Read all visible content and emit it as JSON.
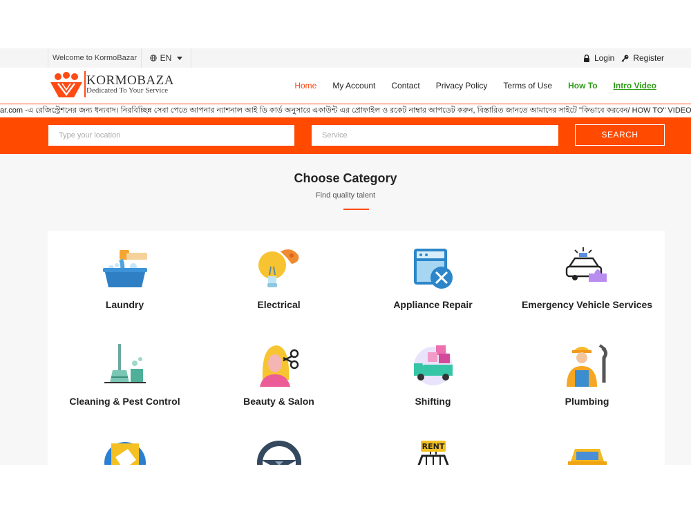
{
  "topbar": {
    "welcome": "Welcome to KormoBazar",
    "language": "EN",
    "login": "Login",
    "register": "Register"
  },
  "logo": {
    "brand": "KORMOBAZAR",
    "tagline": "Dedicated To Your Service"
  },
  "nav": {
    "items": [
      "Home",
      "My Account",
      "Contact",
      "Privacy Policy",
      "Terms of Use",
      "How To",
      "Intro Video"
    ]
  },
  "marquee": {
    "text": "ar.com -এ রেজিস্ট্রেশনের জন্য ধন্যবাদ। নিরবিচ্ছিন্ন সেবা পেতে আপনার ন্যাশনাল আই ডি কার্ড অনুসারে একাউন্ট এর প্রোফাইল ও রকেট নাম্বার আপডেট করুন, বিস্তারিত জানতে আমাদের সাইটে \"কিভাবে করবেন/ HOW TO\" VIDEO গু"
  },
  "search": {
    "location_placeholder": "Type your location",
    "service_placeholder": "Service",
    "button": "SEARCH"
  },
  "section": {
    "title": "Choose Category",
    "subtitle": "Find quality talent"
  },
  "categories": [
    {
      "label": "Laundry",
      "icon": "laundry-icon"
    },
    {
      "label": "Electrical",
      "icon": "lightbulb-icon"
    },
    {
      "label": "Appliance Repair",
      "icon": "appliance-repair-icon"
    },
    {
      "label": "Emergency Vehicle Services",
      "icon": "emergency-vehicle-icon"
    },
    {
      "label": "Cleaning & Pest Control",
      "icon": "cleaning-icon"
    },
    {
      "label": "Beauty & Salon",
      "icon": "beauty-salon-icon"
    },
    {
      "label": "Shifting",
      "icon": "shifting-truck-icon"
    },
    {
      "label": "Plumbing",
      "icon": "plumber-icon"
    },
    {
      "label": "",
      "icon": "painting-icon"
    },
    {
      "label": "",
      "icon": "steering-wheel-icon"
    },
    {
      "label": "",
      "icon": "rent-car-icon"
    },
    {
      "label": "",
      "icon": "taxi-icon"
    }
  ],
  "colors": {
    "accent": "#ff4a00",
    "green": "#2e9c16"
  }
}
